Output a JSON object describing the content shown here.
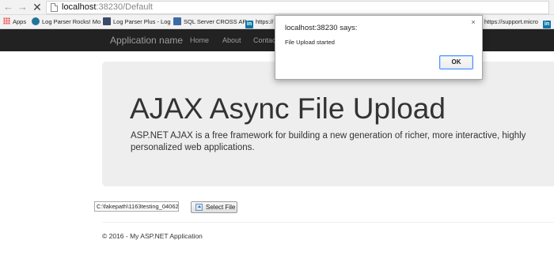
{
  "browser": {
    "url_host": "localhost",
    "url_path": ":38230/Default"
  },
  "bookmarks": [
    {
      "label": "Apps",
      "icon": "apps-icon"
    },
    {
      "label": "Log Parser Rocks! Mo",
      "icon": "wordpress-icon"
    },
    {
      "label": "Log Parser Plus - Log",
      "icon": "log-parser-icon"
    },
    {
      "label": "SQL Server CROSS AP",
      "icon": "sql-server-icon"
    },
    {
      "label": "https://",
      "icon": "linkedin-icon"
    },
    {
      "label": "https://support.micro",
      "icon": "page-icon"
    },
    {
      "label": "",
      "icon": "linkedin-icon"
    }
  ],
  "navbar": {
    "brand": "Application name",
    "links": [
      "Home",
      "About",
      "Contact"
    ]
  },
  "jumbotron": {
    "title": "AJAX Async File Upload",
    "lead": "ASP.NET AJAX is a free framework for building a new generation of richer, more interactive, highly personalized web applications."
  },
  "upload": {
    "file_path": "C:\\fakepath\\1163testing_04062",
    "button_label": "Select File"
  },
  "footer": {
    "text": "© 2016 - My ASP.NET Application"
  },
  "alert": {
    "title": "localhost:38230 says:",
    "message": "File Upload started",
    "ok_label": "OK",
    "close_glyph": "×"
  }
}
